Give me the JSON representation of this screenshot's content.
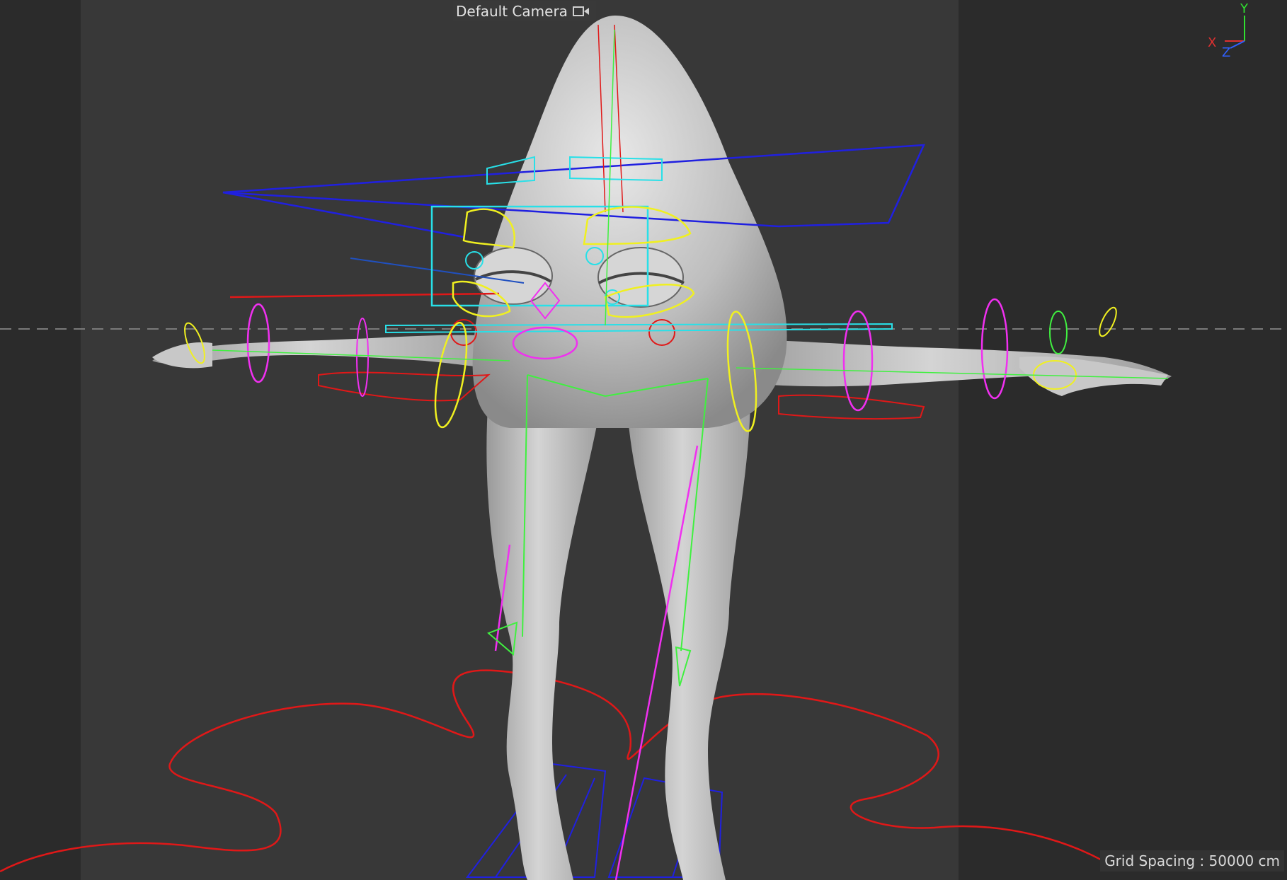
{
  "viewport": {
    "camera_label": "Default Camera",
    "grid_spacing_label": "Grid Spacing : 50000 cm"
  },
  "axes": {
    "x": "X",
    "y": "Y",
    "z": "Z"
  },
  "colors": {
    "viewport_bg": "#2b2b2b",
    "safe_frame": "#3a3a3a",
    "mesh": "#cfcfcf",
    "cyan_controls": "#28e0e8",
    "yellow_controls": "#f0f020",
    "magenta_controls": "#f030f0",
    "green_joints": "#40f040",
    "red_curves": "#e01818",
    "blue_planes": "#2020e0",
    "axis_x": "#e03030",
    "axis_y": "#30e030",
    "axis_z": "#3060ff"
  },
  "icons": [
    "camera-icon",
    "axis-gizmo"
  ]
}
